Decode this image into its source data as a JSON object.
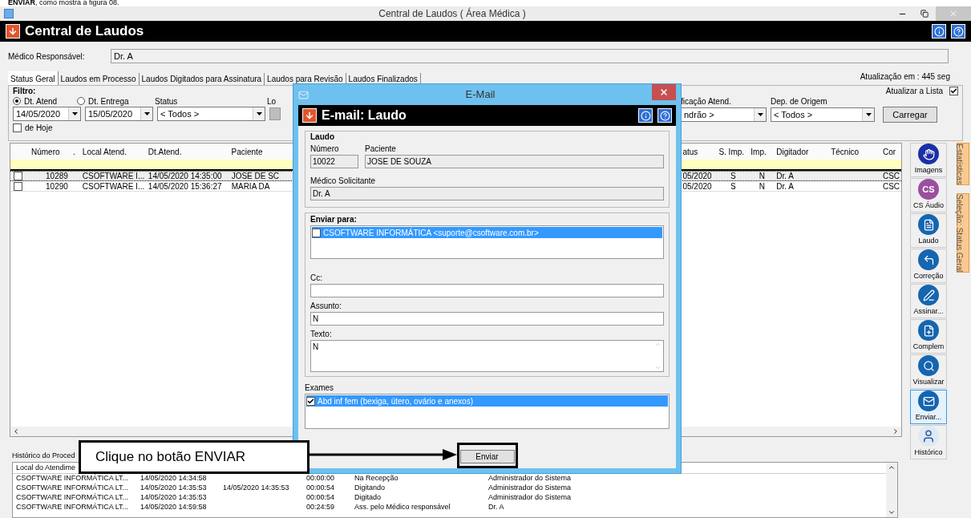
{
  "doc_caption": "**ENVIAR**, como mostra a figura 08.",
  "window": {
    "title": "Central de Laudos ( Área Médica )"
  },
  "header": {
    "title": "Central de Laudos"
  },
  "medico": {
    "label": "Médico Responsável:",
    "value": "Dr. A"
  },
  "refresh_info": "Atualização em : 445 seg",
  "tabs": [
    {
      "label": "Status Geral",
      "selected": true
    },
    {
      "label": "Laudos em Processo",
      "selected": false
    },
    {
      "label": "Laudos Digitados para Assinatura",
      "selected": false
    },
    {
      "label": "Laudos para Revisão",
      "selected": false
    },
    {
      "label": "Laudos Finalizados",
      "selected": false
    }
  ],
  "filter": {
    "title": "Filtro:",
    "radios": [
      {
        "label": "Dt. Atend",
        "selected": true
      },
      {
        "label": "Dt. Entrega",
        "selected": false
      }
    ],
    "date_from": "14/05/2020",
    "date_to": "15/05/2020",
    "status_label": "Status",
    "status_value": "< Todos >",
    "local_label": "Lo",
    "today": {
      "label": "de Hoje",
      "checked": false
    },
    "auto_refresh": {
      "label": "Atualizar a Lista",
      "checked": true
    },
    "classif_label": "ficação Atend.",
    "classif_value": "ndrão >",
    "origem_label": "Dep. de Origem",
    "origem_value": "< Todos >",
    "load_button": "Carregar"
  },
  "grid": {
    "columns_left": [
      "Número",
      ".",
      "Local Atend.",
      "Dt.Atend.",
      "Paciente"
    ],
    "columns_right": [
      "atus",
      "S. Imp.",
      "Imp.",
      "Digitador",
      "Técnico",
      "Cor"
    ],
    "rows": [
      {
        "selected": true,
        "checked": false,
        "numero": "10289",
        "local": "CSOFTWARE I...",
        "dt_atend": "14/05/2020 14:35:00",
        "paciente": "JOSE DE SC",
        "status": "05/2020",
        "s_imp": "S",
        "imp": "N",
        "digitador": "Dr. A",
        "cor": "CSC"
      },
      {
        "selected": false,
        "checked": false,
        "numero": "10290",
        "local": "CSOFTWARE I...",
        "dt_atend": "14/05/2020 15:36:27",
        "paciente": "MARIA DA",
        "status": "05/2020",
        "s_imp": "S",
        "imp": "N",
        "digitador": "Dr. A",
        "cor": "CSC"
      }
    ]
  },
  "side_buttons": [
    {
      "kind": "hand",
      "label": "Imagens",
      "selected": false
    },
    {
      "kind": "cs",
      "label": "CS Áudio",
      "icon_text": "CS",
      "selected": false
    },
    {
      "kind": "document",
      "label": "Laudo",
      "selected": false
    },
    {
      "kind": "correction",
      "label": "Correção",
      "selected": false
    },
    {
      "kind": "sign",
      "label": "Assinar...",
      "selected": false
    },
    {
      "kind": "complement",
      "label": "Complem",
      "selected": false
    },
    {
      "kind": "view",
      "label": "Visualizar",
      "selected": false
    },
    {
      "kind": "mail",
      "label": "Enviar...",
      "selected": true
    },
    {
      "kind": "history",
      "label": "Histórico",
      "selected": false
    }
  ],
  "side_tabs": [
    "Estatísticas",
    "Seleção: Status Geral"
  ],
  "history": {
    "label": "Histórico do Proced",
    "column_1": "Local do Atendime",
    "rows": [
      [
        "CSOFTWARE INFORMÁTICA LT...",
        "14/05/2020 14:34:58",
        null,
        "00:00:00",
        "Na Recepção",
        "Administrador do Sistema"
      ],
      [
        "CSOFTWARE INFORMÁTICA LT...",
        "14/05/2020 14:35:53",
        "14/05/2020 14:35:53",
        "00:00:54",
        "Digitando",
        "Administrador do Sistema"
      ],
      [
        "CSOFTWARE INFORMÁTICA LT...",
        "14/05/2020 14:35:53",
        null,
        "00:00:54",
        "Digitado",
        "Administrador do Sistema"
      ],
      [
        "CSOFTWARE INFORMÁTICA LT...",
        "14/05/2020 14:59:58",
        null,
        "00:24:59",
        "Ass. pelo Médico responsável",
        "Dr. A"
      ]
    ]
  },
  "dialog": {
    "title": "E-Mail",
    "header": "E-mail: Laudo",
    "laudo": {
      "legend": "Laudo",
      "numero_label": "Número",
      "numero": "10022",
      "paciente_label": "Paciente",
      "paciente": "JOSE DE SOUZA",
      "medico_label": "Médico Solicitante",
      "medico": "Dr. A"
    },
    "enviar_para": {
      "legend": "Enviar para:",
      "recipients": [
        {
          "label": "CSOFTWARE INFORMÁTICA <suporte@csoftware.com.br>",
          "checked": false,
          "selected": true
        }
      ],
      "cc_label": "Cc:",
      "assunto_label": "Assunto:",
      "assunto": "N",
      "texto_label": "Texto:",
      "texto": "N"
    },
    "exames_label": "Exames",
    "exames": [
      {
        "label": "Abd inf fem (bexiga, útero, ovário e anexos)",
        "checked": true,
        "selected": true
      }
    ],
    "send_button": "Enviar"
  },
  "callout": "Clique no botão ENVIAR"
}
